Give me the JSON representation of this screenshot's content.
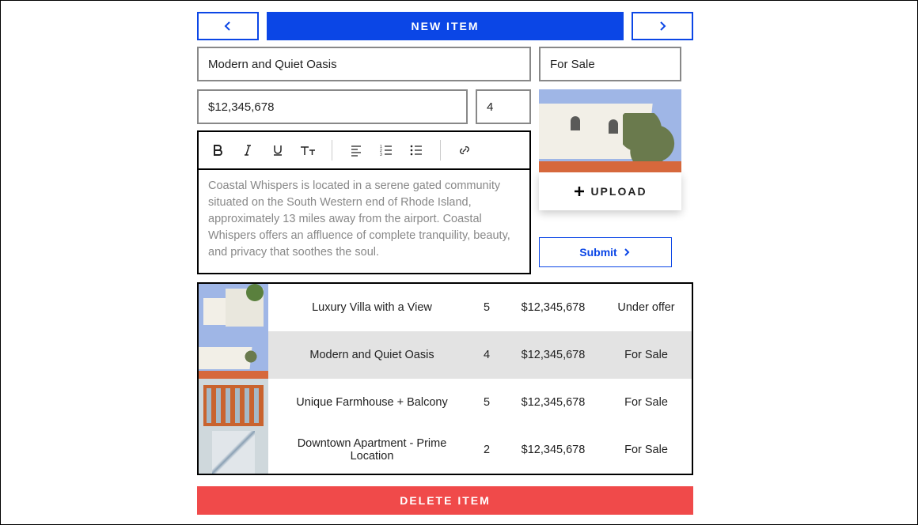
{
  "header": {
    "new_item_label": "NEW ITEM"
  },
  "form": {
    "title": "Modern and Quiet Oasis",
    "price": "$12,345,678",
    "count": "4",
    "status": "For Sale",
    "description": "Coastal Whispers is located in a serene gated community situated on the South Western end of Rhode Island, approximately 13 miles away from the airport. Coastal Whispers offers an affluence of complete tranquility, beauty, and privacy that soothes the soul."
  },
  "upload": {
    "label": "UPLOAD"
  },
  "submit": {
    "label": "Submit"
  },
  "listings": [
    {
      "name": "Luxury Villa with a View",
      "count": "5",
      "price": "$12,345,678",
      "status": "Under offer",
      "selected": false
    },
    {
      "name": "Modern and Quiet Oasis",
      "count": "4",
      "price": "$12,345,678",
      "status": "For Sale",
      "selected": true
    },
    {
      "name": "Unique Farmhouse + Balcony",
      "count": "5",
      "price": "$12,345,678",
      "status": "For Sale",
      "selected": false
    },
    {
      "name": "Downtown Apartment - Prime Location",
      "count": "2",
      "price": "$12,345,678",
      "status": "For Sale",
      "selected": false
    }
  ],
  "delete": {
    "label": "DELETE ITEM"
  }
}
